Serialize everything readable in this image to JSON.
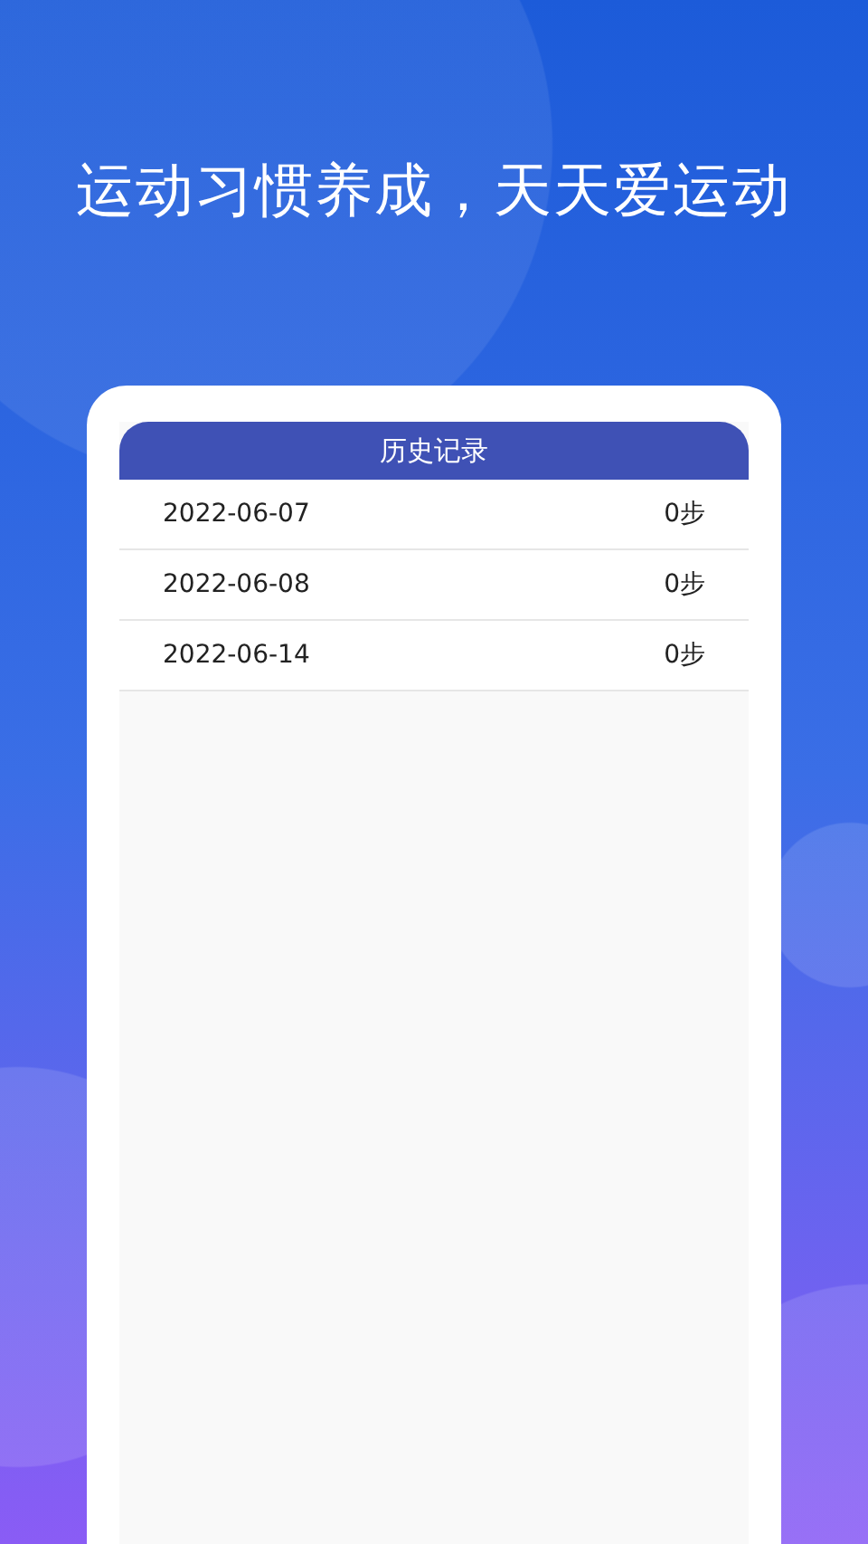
{
  "headline": "运动习惯养成，天天爱运动",
  "history": {
    "title": "历史记录",
    "rows": [
      {
        "date": "2022-06-07",
        "steps": "0步"
      },
      {
        "date": "2022-06-08",
        "steps": "0步"
      },
      {
        "date": "2022-06-14",
        "steps": "0步"
      }
    ]
  }
}
